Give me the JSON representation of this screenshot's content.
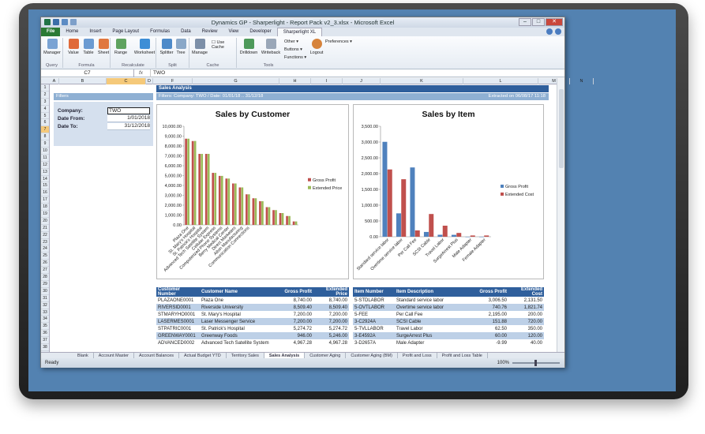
{
  "window": {
    "title": "Dynamics GP - Sharperlight - Report Pack v2_3.xlsx - Microsoft Excel",
    "minimize": "–",
    "maximize": "□",
    "close": "✕"
  },
  "ribbon_tabs": [
    "File",
    "Home",
    "Insert",
    "Page Layout",
    "Formulas",
    "Data",
    "Review",
    "View",
    "Developer",
    "Sharperlight XL"
  ],
  "ribbon": {
    "query": {
      "manager": "Manager",
      "group": "Query"
    },
    "formula": {
      "value": "Value",
      "table": "Table",
      "sheet": "Sheet",
      "group": "Formula"
    },
    "recalculate": {
      "range": "Range",
      "worksheet": "Worksheet",
      "group": "Recalculate"
    },
    "split": {
      "splitter": "Splitter",
      "tree": "Tree",
      "group": "Split"
    },
    "cache": {
      "manage": "Manage",
      "use_cache": "Use Cache",
      "group": "Cache"
    },
    "tools": {
      "drilldown": "Drilldown",
      "writeback": "Writeback",
      "other": "Other",
      "buttons": "Buttons",
      "functions": "Functions",
      "logout": "Logout",
      "preferences": "Preferences",
      "group": "Tools"
    }
  },
  "formula_bar": {
    "name_box": "C7",
    "fx": "fx",
    "value": "TWO"
  },
  "columns": [
    "A",
    "B",
    "C",
    "D",
    "F",
    "G",
    "H",
    "I",
    "J",
    "K",
    "L",
    "M",
    "N"
  ],
  "rows": [
    "1",
    "2",
    "3",
    "4",
    "5",
    "6",
    "7",
    "8",
    "9",
    "10",
    "11",
    "12",
    "13",
    "14",
    "15",
    "16",
    "17",
    "18",
    "19",
    "20",
    "21",
    "22",
    "23",
    "24",
    "25",
    "26",
    "27",
    "28",
    "29",
    "30",
    "31",
    "32",
    "33",
    "34",
    "35",
    "36",
    "37",
    "38"
  ],
  "report": {
    "title": "Sales Analysis",
    "filters_bar": "Filters: Company: TWO / Date: 01/01/18 .. 31/12/18",
    "extracted": "Extracted on 06/08/17 11:18",
    "filters_heading": "Filters",
    "company_label": "Company:",
    "company_value": "TWO",
    "date_from_label": "Date From:",
    "date_from_value": "1/01/2018",
    "date_to_label": "Date To:",
    "date_to_value": "31/12/2018"
  },
  "chart_data": [
    {
      "type": "bar",
      "title": "Sales by Customer",
      "categories": [
        "Plaza One",
        "St. Mary's Hospital",
        "St. Patrick's Hospital",
        "Advanced Tech Satellite System",
        "Cellular Express",
        "Computerized Phone Systems",
        "Berry Medical Center",
        "Direct Marketers",
        "Alton Manufacturing",
        "Communication Connections",
        "",
        "",
        "",
        "",
        "",
        "",
        ""
      ],
      "series": [
        {
          "name": "Gross Profit",
          "color": "#c0504d",
          "values": [
            8740,
            8500,
            7200,
            7200,
            5275,
            4968,
            4700,
            4200,
            3800,
            3100,
            2700,
            2400,
            1800,
            1500,
            1200,
            900,
            350
          ]
        },
        {
          "name": "Extended Price",
          "color": "#9bbb59",
          "values": [
            8740,
            8509,
            7200,
            7200,
            5275,
            4968,
            4700,
            4200,
            3800,
            3100,
            2700,
            2400,
            1800,
            1500,
            1200,
            900,
            350
          ]
        }
      ],
      "y_ticks": [
        "0.00",
        "1,000.00",
        "2,000.00",
        "3,000.00",
        "4,000.00",
        "5,000.00",
        "6,000.00",
        "7,000.00",
        "8,000.00",
        "9,000.00",
        "10,000.00"
      ],
      "ylim": [
        0,
        10000
      ],
      "legend": "right"
    },
    {
      "type": "bar",
      "title": "Sales by Item",
      "categories": [
        "Standard service labor",
        "Overtime service labor",
        "Per Call Fee",
        "SCSI Cable",
        "Travel Labor",
        "SurgeArrest Plus",
        "Male Adapter",
        "Female Adapter"
      ],
      "series": [
        {
          "name": "Gross Profit",
          "color": "#4f81bd",
          "values": [
            3006.5,
            740.76,
            2195,
            151.88,
            62.5,
            60,
            -9.99,
            -10
          ]
        },
        {
          "name": "Extended Cost",
          "color": "#c0504d",
          "values": [
            2131.5,
            1821.74,
            200,
            720,
            350,
            120,
            40,
            40
          ]
        }
      ],
      "y_ticks": [
        "0.00",
        "500.00",
        "1,000.00",
        "1,500.00",
        "2,000.00",
        "2,500.00",
        "3,000.00",
        "3,500.00"
      ],
      "ylim": [
        0,
        3500
      ],
      "legend": "right"
    }
  ],
  "customer_table": {
    "headers": [
      "Customer Number",
      "Customer Name",
      "Gross Profit",
      "Extended Price"
    ],
    "rows": [
      [
        "PLAZAONE0001",
        "Plaza One",
        "8,740.00",
        "8,740.00"
      ],
      [
        "RIVERSID0001",
        "Riverside University",
        "8,509.40",
        "8,509.40"
      ],
      [
        "STMARYHO0001",
        "St. Mary's Hospital",
        "7,200.00",
        "7,200.00"
      ],
      [
        "LASERMES0001",
        "Laser Messenger Service",
        "7,200.00",
        "7,200.00"
      ],
      [
        "STPATRIC0001",
        "St. Patrick's Hospital",
        "5,274.72",
        "5,274.72"
      ],
      [
        "GREENWAY0001",
        "Greenway Foods",
        "946.00",
        "5,246.00"
      ],
      [
        "ADVANCED0002",
        "Advanced Tech Satellite System",
        "4,967.28",
        "4,967.28"
      ]
    ]
  },
  "item_table": {
    "headers": [
      "Item Number",
      "Item Description",
      "Gross Profit",
      "Extended Cost"
    ],
    "rows": [
      [
        "5-STDLABOR",
        "Standard service labor",
        "3,006.50",
        "2,131.50"
      ],
      [
        "5-OVTLABOR",
        "Overtime service labor",
        "740.76",
        "1,821.74"
      ],
      [
        "5-FEE",
        "Per Call Fee",
        "2,195.00",
        "200.00"
      ],
      [
        "3-C2924A",
        "SCSI Cable",
        "151.88",
        "720.00"
      ],
      [
        "5-TVLLABOR",
        "Travel Labor",
        "62.50",
        "350.00"
      ],
      [
        "3-E4592A",
        "SurgeArrest Plus",
        "60.00",
        "120.00"
      ],
      [
        "3-D2657A",
        "Male Adapter",
        "-9.99",
        "40.00"
      ]
    ]
  },
  "sheet_tabs": [
    "Blank",
    "Account Master",
    "Account Balances",
    "Actual Budget YTD",
    "Territory Sales",
    "Sales Analysis",
    "Customer Aging",
    "Customer Aging (BM)",
    "Profit and Loss",
    "Profit and Loss Table"
  ],
  "active_sheet": "Sales Analysis",
  "status": {
    "ready": "Ready",
    "zoom": "100%"
  }
}
